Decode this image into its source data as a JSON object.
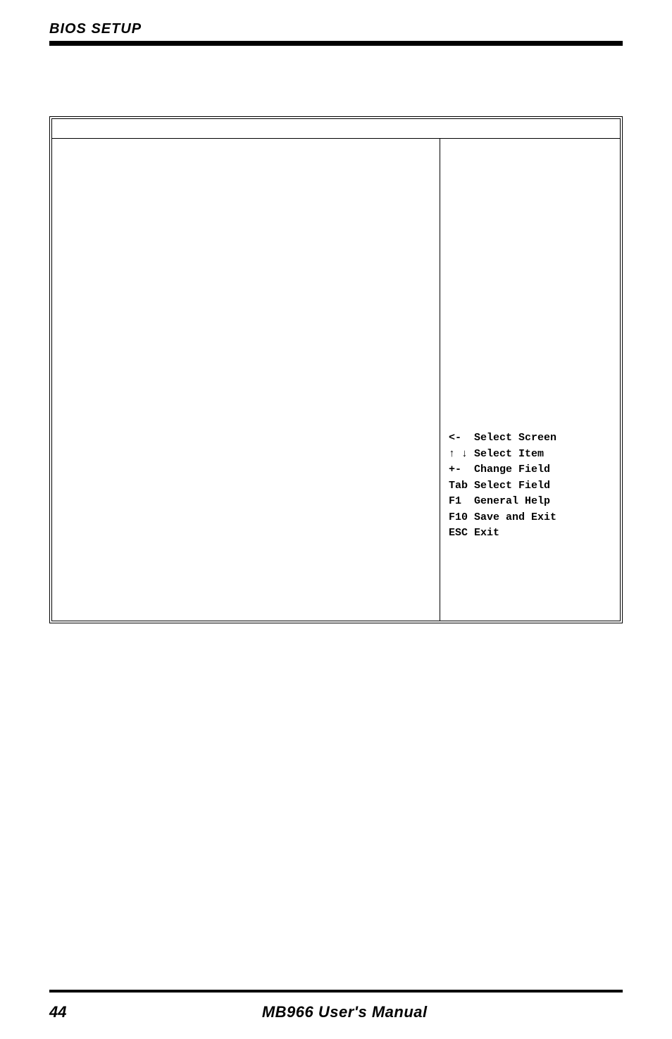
{
  "header": {
    "title": "BIOS SETUP"
  },
  "help_panel": {
    "lines": [
      "<-  Select Screen",
      "↑ ↓ Select Item",
      "+-  Change Field",
      "Tab Select Field",
      "F1  General Help",
      "F10 Save and Exit",
      "ESC Exit"
    ]
  },
  "footer": {
    "page_number": "44",
    "title": "MB966 User's Manual"
  }
}
